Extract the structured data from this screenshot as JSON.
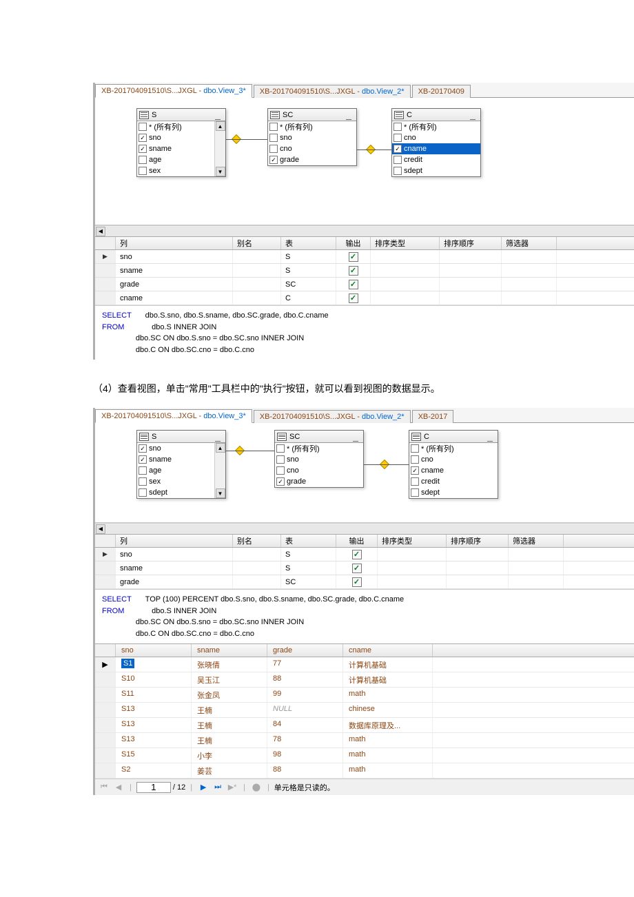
{
  "tabs1": [
    {
      "pre": "XB-201704091510\\S...JXGL - ",
      "main": "dbo.View_3*",
      "active": true
    },
    {
      "pre": "XB-201704091510\\S...JXGL - ",
      "main": "dbo.View_2*",
      "active": false
    },
    {
      "pre": "XB-20170409",
      "main": "",
      "active": false
    }
  ],
  "tabs2": [
    {
      "pre": "XB-201704091510\\S...JXGL - ",
      "main": "dbo.View_3*",
      "active": true
    },
    {
      "pre": "XB-201704091510\\S...JXGL - ",
      "main": "dbo.View_2*",
      "active": false
    },
    {
      "pre": "XB-2017",
      "main": "",
      "active": false
    }
  ],
  "tableS": {
    "name": "S",
    "cols": [
      "* (所有列)",
      "sno",
      "sname",
      "age",
      "sex"
    ],
    "checked": [
      false,
      true,
      true,
      false,
      false
    ]
  },
  "tableSC": {
    "name": "SC",
    "cols": [
      "* (所有列)",
      "sno",
      "cno",
      "grade"
    ],
    "checked": [
      false,
      false,
      false,
      true
    ]
  },
  "tableC": {
    "name": "C",
    "cols": [
      "* (所有列)",
      "cno",
      "cname",
      "credit",
      "sdept"
    ],
    "checked": [
      false,
      false,
      true,
      false,
      false
    ],
    "sel": "cname"
  },
  "tableS2": {
    "name": "S",
    "cols": [
      "sno",
      "sname",
      "age",
      "sex",
      "sdept"
    ],
    "checked": [
      true,
      true,
      false,
      false,
      false
    ]
  },
  "tableSC2": {
    "name": "SC",
    "cols": [
      "* (所有列)",
      "sno",
      "cno",
      "grade"
    ],
    "checked": [
      false,
      false,
      false,
      true
    ]
  },
  "tableC2": {
    "name": "C",
    "cols": [
      "* (所有列)",
      "cno",
      "cname",
      "credit",
      "sdept"
    ],
    "checked": [
      false,
      false,
      true,
      false,
      false
    ]
  },
  "gridHeaders": {
    "col": "列",
    "alias": "别名",
    "table": "表",
    "output": "输出",
    "sortType": "排序类型",
    "sortOrder": "排序顺序",
    "filter": "筛选器"
  },
  "grid1": [
    {
      "col": "sno",
      "tbl": "S",
      "out": true,
      "cur": true
    },
    {
      "col": "sname",
      "tbl": "S",
      "out": true
    },
    {
      "col": "grade",
      "tbl": "SC",
      "out": true
    },
    {
      "col": "cname",
      "tbl": "C",
      "out": true
    }
  ],
  "grid2": [
    {
      "col": "sno",
      "tbl": "S",
      "out": true,
      "cur": true
    },
    {
      "col": "sname",
      "tbl": "S",
      "out": true
    },
    {
      "col": "grade",
      "tbl": "SC",
      "out": true
    }
  ],
  "sql1": {
    "select": "SELECT",
    "selCols": "dbo.S.sno, dbo.S.sname, dbo.SC.grade, dbo.C.cname",
    "from": "FROM",
    "body": "dbo.S INNER JOIN\n                dbo.SC ON dbo.S.sno = dbo.SC.sno INNER JOIN\n                dbo.C ON dbo.SC.cno = dbo.C.cno"
  },
  "sql2": {
    "select": "SELECT",
    "selCols": "TOP (100) PERCENT dbo.S.sno, dbo.S.sname, dbo.SC.grade, dbo.C.cname",
    "from": "FROM",
    "body": "dbo.S INNER JOIN\n                dbo.SC ON dbo.S.sno = dbo.SC.sno INNER JOIN\n                dbo.C ON dbo.SC.cno = dbo.C.cno"
  },
  "caption": "（4）查看视图，单击\"常用\"工具栏中的\"执行\"按钮，就可以看到视图的数据显示。",
  "resultHeaders": [
    "sno",
    "sname",
    "grade",
    "cname"
  ],
  "results": [
    {
      "sno": "S1",
      "sname": "张晓倩",
      "grade": "77",
      "cname": "计算机基础",
      "cur": true,
      "sel": true
    },
    {
      "sno": "S10",
      "sname": "吴玉江",
      "grade": "88",
      "cname": "计算机基础"
    },
    {
      "sno": "S11",
      "sname": "张金凤",
      "grade": "99",
      "cname": "math"
    },
    {
      "sno": "S13",
      "sname": "王楠",
      "grade": "NULL",
      "cname": "chinese",
      "null": true
    },
    {
      "sno": "S13",
      "sname": "王楠",
      "grade": "84",
      "cname": "数据库原理及..."
    },
    {
      "sno": "S13",
      "sname": "王楠",
      "grade": "78",
      "cname": "math"
    },
    {
      "sno": "S15",
      "sname": "小李",
      "grade": "98",
      "cname": "math"
    },
    {
      "sno": "S2",
      "sname": "姜芸",
      "grade": "88",
      "cname": "math"
    }
  ],
  "nav": {
    "pos": "1",
    "total": "/ 12",
    "msg": "单元格是只读的。"
  }
}
